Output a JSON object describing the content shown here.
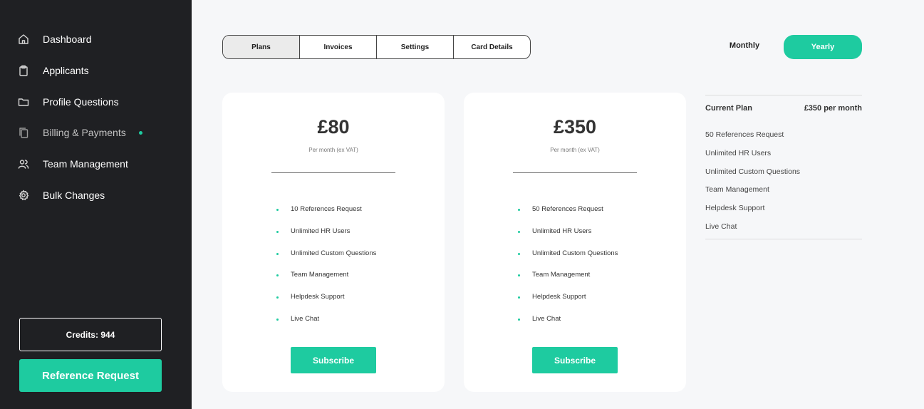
{
  "sidebar": {
    "items": [
      {
        "label": "Dashboard",
        "icon": "home-icon"
      },
      {
        "label": "Applicants",
        "icon": "clipboard-icon"
      },
      {
        "label": "Profile Questions",
        "icon": "folder-icon"
      },
      {
        "label": "Billing & Payments",
        "icon": "copy-icon",
        "active": true
      },
      {
        "label": "Team Management",
        "icon": "users-icon"
      },
      {
        "label": "Bulk Changes",
        "icon": "gear-icon"
      }
    ],
    "credits_label": "Credits: 944",
    "reference_button": "Reference Request"
  },
  "tabs": [
    {
      "label": "Plans",
      "active": true
    },
    {
      "label": "Invoices"
    },
    {
      "label": "Settings"
    },
    {
      "label": "Card Details"
    }
  ],
  "billing_toggle": {
    "monthly_label": "Monthly",
    "yearly_label": "Yearly",
    "selected": "Yearly"
  },
  "plans": [
    {
      "price": "£80",
      "period": "Per month (ex VAT)",
      "features": [
        "10 References Request",
        "Unlimited HR Users",
        "Unlimited Custom Questions",
        "Team Management",
        "Helpdesk Support",
        "Live Chat"
      ],
      "button": "Subscribe"
    },
    {
      "price": "£350",
      "period": "Per month (ex VAT)",
      "features": [
        "50 References Request",
        "Unlimited HR Users",
        "Unlimited Custom Questions",
        "Team Management",
        "Helpdesk Support",
        "Live Chat"
      ],
      "button": "Subscribe"
    }
  ],
  "current_plan": {
    "title": "Current Plan",
    "price": "£350 per month",
    "features": [
      "50 References Request",
      "Unlimited HR Users",
      "Unlimited Custom Questions",
      "Team Management",
      "Helpdesk Support",
      "Live Chat"
    ]
  },
  "colors": {
    "accent": "#1ecba0",
    "sidebar_bg": "#1f2023",
    "page_bg": "#f6f7f9"
  }
}
